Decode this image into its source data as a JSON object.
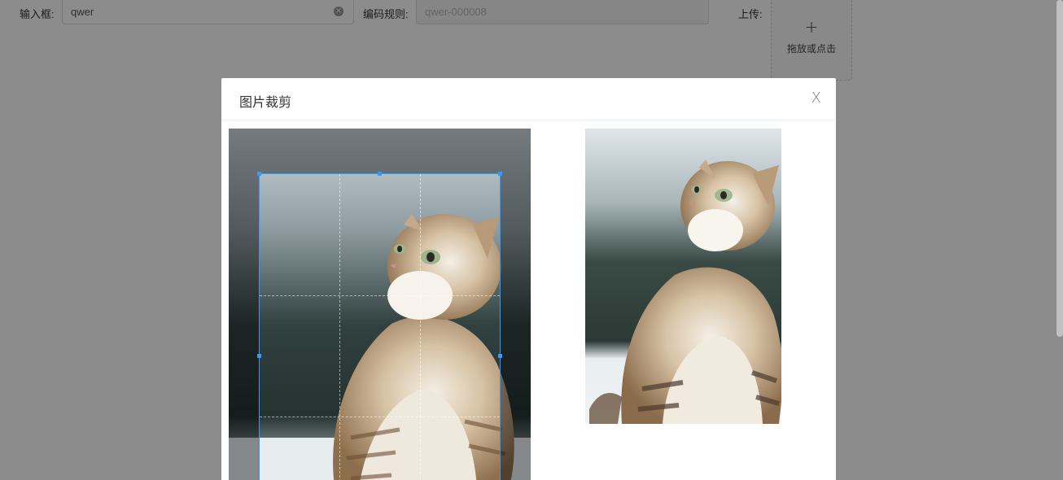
{
  "form": {
    "input_label": "输入框:",
    "input_value": "qwer",
    "code_label": "编码规则:",
    "code_placeholder": "qwer-000008",
    "upload_label": "上传:",
    "upload_plus": "+",
    "upload_text": "拖放或点击"
  },
  "modal": {
    "title": "图片裁剪",
    "close_glyph": "X"
  },
  "icons": {
    "clear": "close-circle-icon",
    "close": "close-icon",
    "upload": "plus-icon"
  },
  "colors": {
    "crop_accent": "#3399ff",
    "mask": "rgba(0,0,0,0.45)"
  }
}
